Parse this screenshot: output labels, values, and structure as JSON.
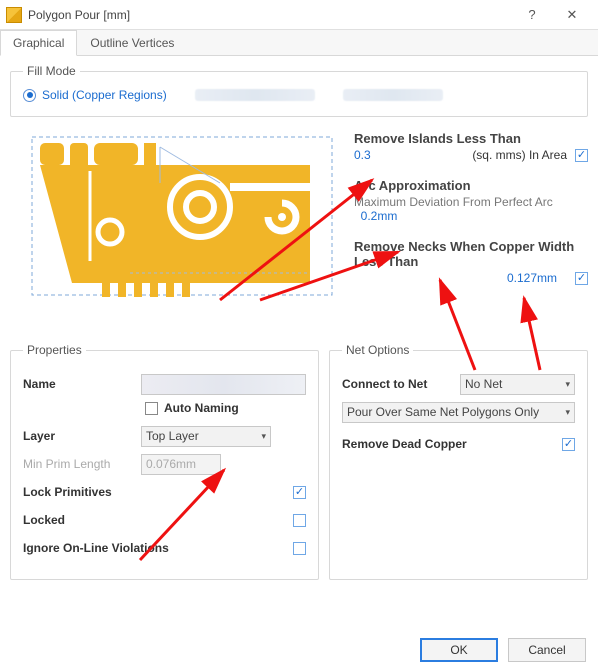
{
  "title": "Polygon Pour [mm]",
  "tabs": {
    "graphical": "Graphical",
    "outline": "Outline Vertices"
  },
  "fillmode": {
    "legend": "Fill Mode",
    "solid_label": "Solid (Copper Regions)"
  },
  "settings": {
    "removeIslands": {
      "title": "Remove Islands Less Than",
      "value": "0.3",
      "suffix": "(sq. mms) In Area",
      "checked": true
    },
    "arcApprox": {
      "title": "Arc Approximation",
      "subtitle": "Maximum Deviation From Perfect Arc",
      "value": "0.2mm"
    },
    "removeNecks": {
      "title": "Remove Necks When Copper Width Less Than",
      "value": "0.127mm",
      "checked": true
    }
  },
  "properties": {
    "legend": "Properties",
    "name_label": "Name",
    "name_value": "",
    "auto_naming_label": "Auto Naming",
    "layer_label": "Layer",
    "layer_value": "Top Layer",
    "min_prim_label": "Min Prim Length",
    "min_prim_value": "0.076mm",
    "lock_primitives_label": "Lock Primitives",
    "lock_primitives_checked": true,
    "locked_label": "Locked",
    "locked_checked": false,
    "ignore_violations_label": "Ignore On-Line Violations",
    "ignore_violations_checked": false
  },
  "netoptions": {
    "legend": "Net Options",
    "connect_label": "Connect to Net",
    "connect_value": "No Net",
    "pour_rule": "Pour Over Same Net Polygons Only",
    "remove_dead_label": "Remove Dead Copper",
    "remove_dead_checked": true
  },
  "buttons": {
    "ok": "OK",
    "cancel": "Cancel"
  }
}
